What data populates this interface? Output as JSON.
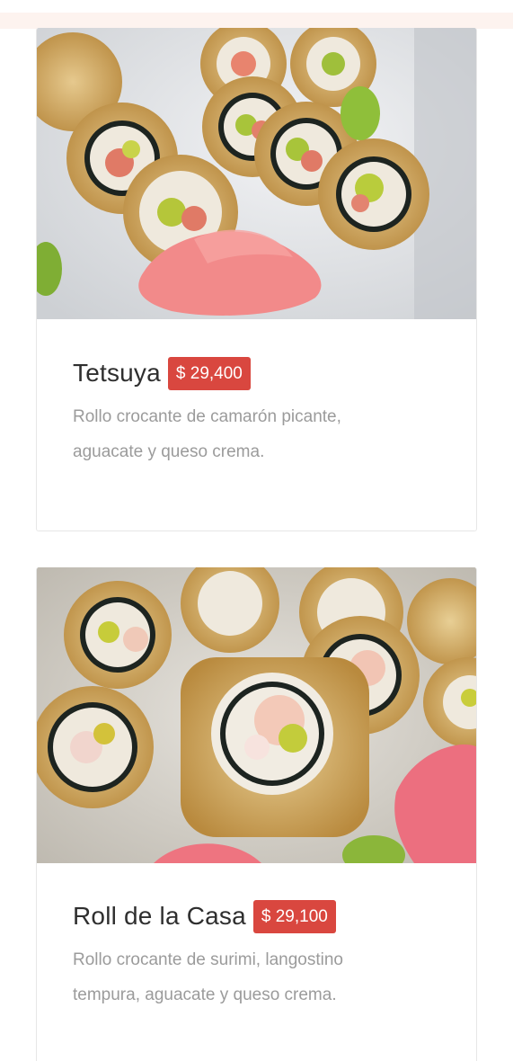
{
  "menu_items": [
    {
      "name": "Tetsuya",
      "price": "$ 29,400",
      "description": "Rollo crocante de camarón picante, aguacate y queso crema.",
      "image_alt": "sushi-rolls-photo"
    },
    {
      "name": "Roll de la Casa",
      "price": "$ 29,100",
      "description": "Rollo crocante de surimi, langostino tempura, aguacate y queso crema.",
      "image_alt": "sushi-rolls-photo"
    }
  ],
  "colors": {
    "price_badge": "#d9473f",
    "title_text": "#2f2f2f",
    "description_text": "#9b9b9b"
  }
}
